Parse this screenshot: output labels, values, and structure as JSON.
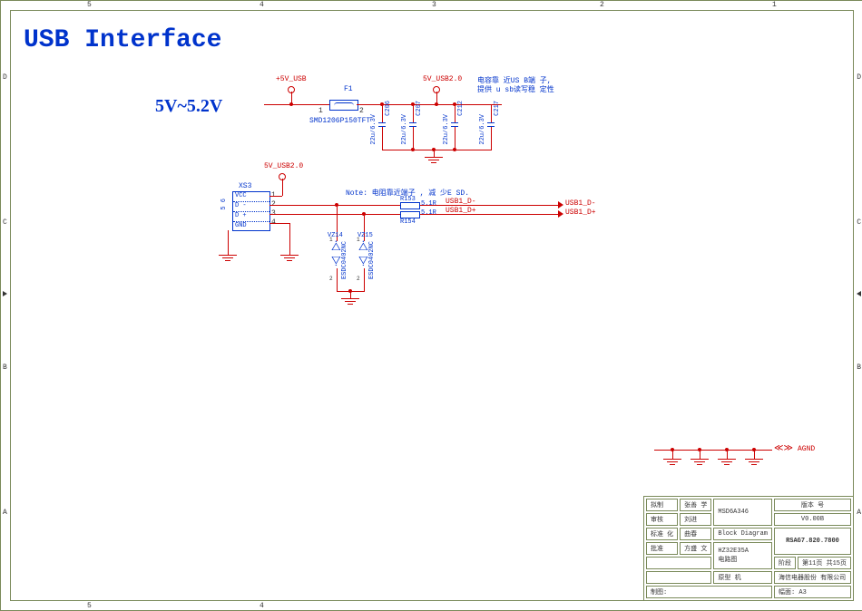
{
  "title": "USB Interface",
  "voltage": "5V~5.2V",
  "nets": {
    "p5v_usb": "+5V_USB",
    "p5v_usb2": "5V_USB2.0",
    "p5v_usb2b": "5V_USB2.0",
    "usb1_dminus": "USB1_D-",
    "usb1_dplus": "USB1_D+",
    "usb1_dminus_out": "USB1_D-",
    "usb1_dplus_out": "USB1_D+",
    "agnd": "AGND"
  },
  "refs": {
    "f1": "F1",
    "f1_part": "SMD1206P150TFT",
    "xs3": "XS3",
    "c206": "C206",
    "c207": "C207",
    "c212": "C212",
    "c217": "C217",
    "c_val": "22u/6.3V",
    "r153": "R153",
    "r154": "R154",
    "r_val": "5.1R",
    "vz14": "VZ14",
    "vz15": "VZ15",
    "vz_part": "ESDC0402NC"
  },
  "pins": {
    "p1": "1",
    "p2": "2",
    "p3": "3",
    "p4": "4",
    "p5": "5",
    "p6": "6",
    "vcc": "VCC",
    "dminus": "D -",
    "dplus": "D +",
    "gnd": "GND"
  },
  "notes": {
    "note1a": "电容靠 近US B端 子,",
    "note1b": "提供  u sb读写稳 定性",
    "note2": "Note: 电阻靠近端子 , 减 少E SD."
  },
  "titleblock": {
    "role1": "拟制",
    "name1": "张善 学",
    "role2": "审核",
    "name2": "刘进",
    "role3": "标准 化",
    "name3": "曲春",
    "role4": "批准",
    "name4": "方盛 文",
    "project": "MSD6A346",
    "subtitle": "Block Diagram",
    "model": "HZ32E35A",
    "model_sub": "电路图",
    "ver_label": "版本 号",
    "ver": "V0.00B",
    "drawing": "RSAG7.820.7800",
    "stage_label": "阶段",
    "page_label": "第11页  共15页",
    "orig_label": "原型 机",
    "company": "海信电器股份 有限公司",
    "drawn_label": "制图:",
    "sheet_label": "幅面: A3"
  },
  "border": {
    "letters": [
      "A",
      "B",
      "C",
      "D"
    ],
    "numbers": [
      "1",
      "2",
      "3",
      "4",
      "5"
    ]
  }
}
